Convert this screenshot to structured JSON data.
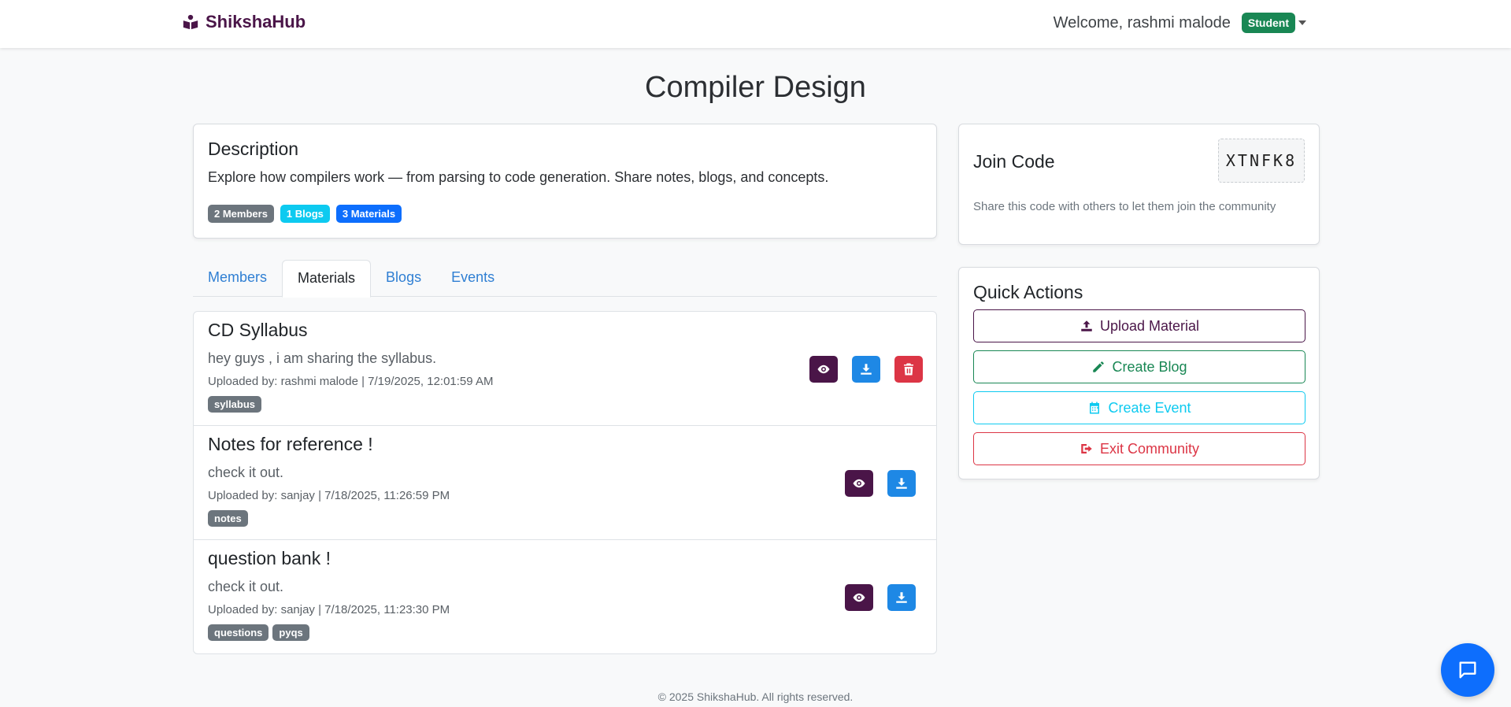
{
  "navbar": {
    "brand": "ShikshaHub",
    "welcome": "Welcome, rashmi malode",
    "role": "Student"
  },
  "page": {
    "title": "Compiler Design"
  },
  "description": {
    "heading": "Description",
    "text": "Explore how compilers work — from parsing to code generation. Share notes, blogs, and concepts.",
    "badges": [
      "2 Members",
      "1 Blogs",
      "3 Materials"
    ]
  },
  "join": {
    "heading": "Join Code",
    "code": "XTNFK8",
    "note": "Share this code with others to let them join the community"
  },
  "quick_actions": {
    "heading": "Quick Actions",
    "buttons": [
      "Upload Material",
      "Create Blog",
      "Create Event",
      "Exit Community"
    ]
  },
  "tabs": [
    "Members",
    "Materials",
    "Blogs",
    "Events"
  ],
  "materials": [
    {
      "title": "CD Syllabus",
      "desc": "hey guys , i am sharing the syllabus.",
      "meta": "Uploaded by: rashmi malode | 7/19/2025, 12:01:59 AM",
      "tags": [
        "syllabus"
      ]
    },
    {
      "title": "Notes for reference !",
      "desc": "check it out.",
      "meta": "Uploaded by: sanjay | 7/18/2025, 11:26:59 PM",
      "tags": [
        "notes"
      ]
    },
    {
      "title": "question bank !",
      "desc": "check it out.",
      "meta": "Uploaded by: sanjay | 7/18/2025, 11:23:30 PM",
      "tags": [
        "questions",
        "pyqs"
      ]
    }
  ],
  "footer": "© 2025 ShikshaHub. All rights reserved.",
  "colors": {
    "brand": "#4a1548",
    "accent": "#0d6efd",
    "success": "#198754",
    "danger": "#dc3545",
    "info": "#0dcaf0"
  }
}
